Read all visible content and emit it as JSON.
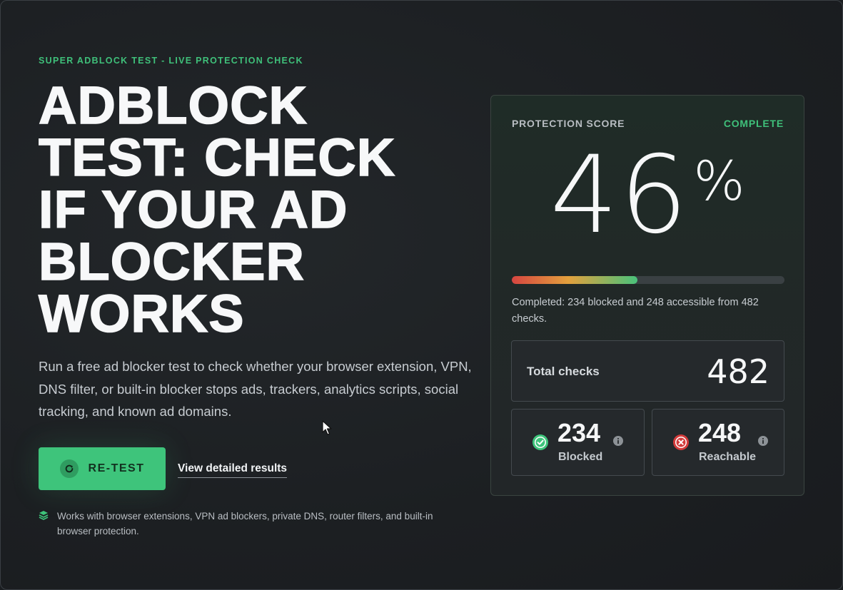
{
  "hero": {
    "eyebrow": "SUPER ADBLOCK TEST - LIVE PROTECTION CHECK",
    "title_lines": [
      "ADBLOCK",
      "TEST: CHECK",
      "IF YOUR AD",
      "BLOCKER",
      "WORKS"
    ],
    "lead": "Run a free ad blocker test to check whether your browser extension, VPN, DNS filter, or built-in blocker stops ads, trackers, analytics scripts, social tracking, and known ad domains.",
    "retest_label": "RE-TEST",
    "retest_icon": "refresh-icon",
    "details_link": "View detailed results",
    "note_icon": "layers-icon",
    "note": "Works with browser extensions, VPN ad blockers, private DNS, router filters, and built-in browser protection."
  },
  "score_panel": {
    "label": "PROTECTION SCORE",
    "status": "COMPLETE",
    "score": "46",
    "percent_sign": "%",
    "progress_fraction": 0.46,
    "summary": "Completed: 234 blocked and 248 accessible from 482 checks.",
    "total_label": "Total checks",
    "total_value": "482",
    "blocked": {
      "value": "234",
      "label": "Blocked",
      "icon": "check-circle-icon"
    },
    "reachable": {
      "value": "248",
      "label": "Reachable",
      "icon": "x-circle-icon"
    }
  },
  "colors": {
    "accent": "#3ec47b",
    "danger": "#d33b3b",
    "background": "#1b1e21"
  }
}
